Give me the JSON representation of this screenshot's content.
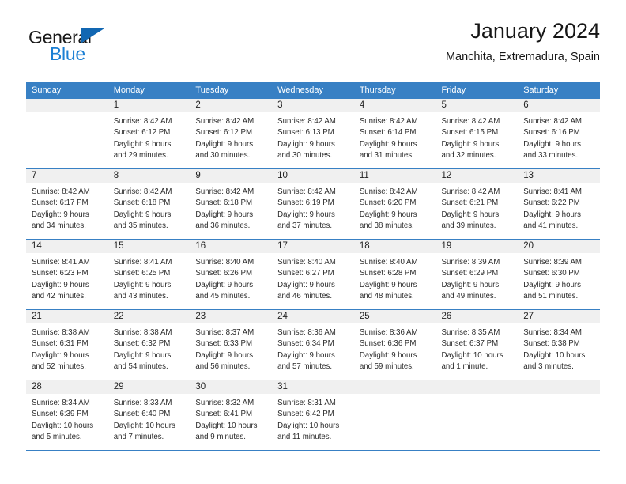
{
  "brand": {
    "name_part1": "General",
    "name_part2": "Blue",
    "accent_color": "#1b7fd4",
    "triangle_color": "#1267b2"
  },
  "header": {
    "title": "January 2024",
    "subtitle": "Manchita, Extremadura, Spain"
  },
  "theme": {
    "header_row_bg": "#3880c4",
    "daynum_band_bg": "#f0f0f0",
    "grid_line": "#3880c4"
  },
  "columns": [
    "Sunday",
    "Monday",
    "Tuesday",
    "Wednesday",
    "Thursday",
    "Friday",
    "Saturday"
  ],
  "weeks": [
    [
      {
        "day": "",
        "empty": true,
        "sunrise": "",
        "sunset": "",
        "daylight_l1": "",
        "daylight_l2": ""
      },
      {
        "day": "1",
        "sunrise": "Sunrise: 8:42 AM",
        "sunset": "Sunset: 6:12 PM",
        "daylight_l1": "Daylight: 9 hours",
        "daylight_l2": "and 29 minutes."
      },
      {
        "day": "2",
        "sunrise": "Sunrise: 8:42 AM",
        "sunset": "Sunset: 6:12 PM",
        "daylight_l1": "Daylight: 9 hours",
        "daylight_l2": "and 30 minutes."
      },
      {
        "day": "3",
        "sunrise": "Sunrise: 8:42 AM",
        "sunset": "Sunset: 6:13 PM",
        "daylight_l1": "Daylight: 9 hours",
        "daylight_l2": "and 30 minutes."
      },
      {
        "day": "4",
        "sunrise": "Sunrise: 8:42 AM",
        "sunset": "Sunset: 6:14 PM",
        "daylight_l1": "Daylight: 9 hours",
        "daylight_l2": "and 31 minutes."
      },
      {
        "day": "5",
        "sunrise": "Sunrise: 8:42 AM",
        "sunset": "Sunset: 6:15 PM",
        "daylight_l1": "Daylight: 9 hours",
        "daylight_l2": "and 32 minutes."
      },
      {
        "day": "6",
        "sunrise": "Sunrise: 8:42 AM",
        "sunset": "Sunset: 6:16 PM",
        "daylight_l1": "Daylight: 9 hours",
        "daylight_l2": "and 33 minutes."
      }
    ],
    [
      {
        "day": "7",
        "sunrise": "Sunrise: 8:42 AM",
        "sunset": "Sunset: 6:17 PM",
        "daylight_l1": "Daylight: 9 hours",
        "daylight_l2": "and 34 minutes."
      },
      {
        "day": "8",
        "sunrise": "Sunrise: 8:42 AM",
        "sunset": "Sunset: 6:18 PM",
        "daylight_l1": "Daylight: 9 hours",
        "daylight_l2": "and 35 minutes."
      },
      {
        "day": "9",
        "sunrise": "Sunrise: 8:42 AM",
        "sunset": "Sunset: 6:18 PM",
        "daylight_l1": "Daylight: 9 hours",
        "daylight_l2": "and 36 minutes."
      },
      {
        "day": "10",
        "sunrise": "Sunrise: 8:42 AM",
        "sunset": "Sunset: 6:19 PM",
        "daylight_l1": "Daylight: 9 hours",
        "daylight_l2": "and 37 minutes."
      },
      {
        "day": "11",
        "sunrise": "Sunrise: 8:42 AM",
        "sunset": "Sunset: 6:20 PM",
        "daylight_l1": "Daylight: 9 hours",
        "daylight_l2": "and 38 minutes."
      },
      {
        "day": "12",
        "sunrise": "Sunrise: 8:42 AM",
        "sunset": "Sunset: 6:21 PM",
        "daylight_l1": "Daylight: 9 hours",
        "daylight_l2": "and 39 minutes."
      },
      {
        "day": "13",
        "sunrise": "Sunrise: 8:41 AM",
        "sunset": "Sunset: 6:22 PM",
        "daylight_l1": "Daylight: 9 hours",
        "daylight_l2": "and 41 minutes."
      }
    ],
    [
      {
        "day": "14",
        "sunrise": "Sunrise: 8:41 AM",
        "sunset": "Sunset: 6:23 PM",
        "daylight_l1": "Daylight: 9 hours",
        "daylight_l2": "and 42 minutes."
      },
      {
        "day": "15",
        "sunrise": "Sunrise: 8:41 AM",
        "sunset": "Sunset: 6:25 PM",
        "daylight_l1": "Daylight: 9 hours",
        "daylight_l2": "and 43 minutes."
      },
      {
        "day": "16",
        "sunrise": "Sunrise: 8:40 AM",
        "sunset": "Sunset: 6:26 PM",
        "daylight_l1": "Daylight: 9 hours",
        "daylight_l2": "and 45 minutes."
      },
      {
        "day": "17",
        "sunrise": "Sunrise: 8:40 AM",
        "sunset": "Sunset: 6:27 PM",
        "daylight_l1": "Daylight: 9 hours",
        "daylight_l2": "and 46 minutes."
      },
      {
        "day": "18",
        "sunrise": "Sunrise: 8:40 AM",
        "sunset": "Sunset: 6:28 PM",
        "daylight_l1": "Daylight: 9 hours",
        "daylight_l2": "and 48 minutes."
      },
      {
        "day": "19",
        "sunrise": "Sunrise: 8:39 AM",
        "sunset": "Sunset: 6:29 PM",
        "daylight_l1": "Daylight: 9 hours",
        "daylight_l2": "and 49 minutes."
      },
      {
        "day": "20",
        "sunrise": "Sunrise: 8:39 AM",
        "sunset": "Sunset: 6:30 PM",
        "daylight_l1": "Daylight: 9 hours",
        "daylight_l2": "and 51 minutes."
      }
    ],
    [
      {
        "day": "21",
        "sunrise": "Sunrise: 8:38 AM",
        "sunset": "Sunset: 6:31 PM",
        "daylight_l1": "Daylight: 9 hours",
        "daylight_l2": "and 52 minutes."
      },
      {
        "day": "22",
        "sunrise": "Sunrise: 8:38 AM",
        "sunset": "Sunset: 6:32 PM",
        "daylight_l1": "Daylight: 9 hours",
        "daylight_l2": "and 54 minutes."
      },
      {
        "day": "23",
        "sunrise": "Sunrise: 8:37 AM",
        "sunset": "Sunset: 6:33 PM",
        "daylight_l1": "Daylight: 9 hours",
        "daylight_l2": "and 56 minutes."
      },
      {
        "day": "24",
        "sunrise": "Sunrise: 8:36 AM",
        "sunset": "Sunset: 6:34 PM",
        "daylight_l1": "Daylight: 9 hours",
        "daylight_l2": "and 57 minutes."
      },
      {
        "day": "25",
        "sunrise": "Sunrise: 8:36 AM",
        "sunset": "Sunset: 6:36 PM",
        "daylight_l1": "Daylight: 9 hours",
        "daylight_l2": "and 59 minutes."
      },
      {
        "day": "26",
        "sunrise": "Sunrise: 8:35 AM",
        "sunset": "Sunset: 6:37 PM",
        "daylight_l1": "Daylight: 10 hours",
        "daylight_l2": "and 1 minute."
      },
      {
        "day": "27",
        "sunrise": "Sunrise: 8:34 AM",
        "sunset": "Sunset: 6:38 PM",
        "daylight_l1": "Daylight: 10 hours",
        "daylight_l2": "and 3 minutes."
      }
    ],
    [
      {
        "day": "28",
        "sunrise": "Sunrise: 8:34 AM",
        "sunset": "Sunset: 6:39 PM",
        "daylight_l1": "Daylight: 10 hours",
        "daylight_l2": "and 5 minutes."
      },
      {
        "day": "29",
        "sunrise": "Sunrise: 8:33 AM",
        "sunset": "Sunset: 6:40 PM",
        "daylight_l1": "Daylight: 10 hours",
        "daylight_l2": "and 7 minutes."
      },
      {
        "day": "30",
        "sunrise": "Sunrise: 8:32 AM",
        "sunset": "Sunset: 6:41 PM",
        "daylight_l1": "Daylight: 10 hours",
        "daylight_l2": "and 9 minutes."
      },
      {
        "day": "31",
        "sunrise": "Sunrise: 8:31 AM",
        "sunset": "Sunset: 6:42 PM",
        "daylight_l1": "Daylight: 10 hours",
        "daylight_l2": "and 11 minutes."
      },
      {
        "day": "",
        "empty": true,
        "sunrise": "",
        "sunset": "",
        "daylight_l1": "",
        "daylight_l2": ""
      },
      {
        "day": "",
        "empty": true,
        "sunrise": "",
        "sunset": "",
        "daylight_l1": "",
        "daylight_l2": ""
      },
      {
        "day": "",
        "empty": true,
        "sunrise": "",
        "sunset": "",
        "daylight_l1": "",
        "daylight_l2": ""
      }
    ]
  ]
}
